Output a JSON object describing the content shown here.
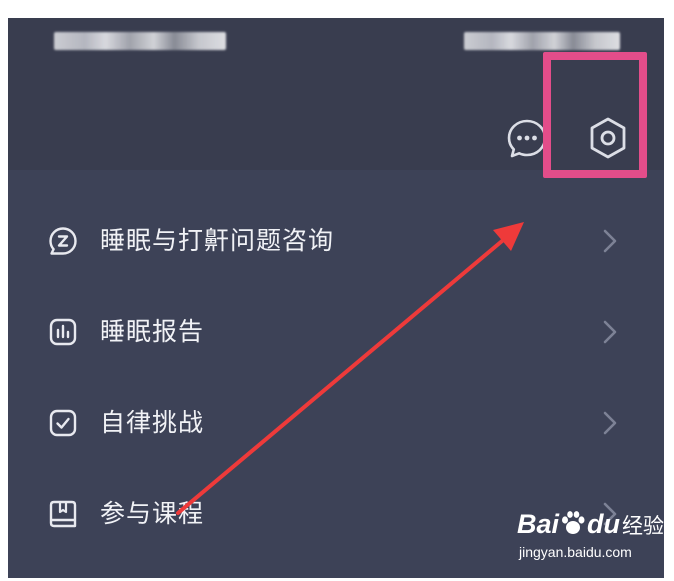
{
  "header": {
    "chat_icon": "chat-bubble-dots-icon",
    "settings_icon": "hexagon-gear-icon"
  },
  "menu": {
    "items": [
      {
        "label": "睡眠与打鼾问题咨询",
        "icon": "chat-bubble-z-icon"
      },
      {
        "label": "睡眠报告",
        "icon": "bar-chart-icon"
      },
      {
        "label": "自律挑战",
        "icon": "checkbox-icon"
      },
      {
        "label": "参与课程",
        "icon": "book-icon"
      }
    ]
  },
  "annotation": {
    "highlight_color": "#e34d8a",
    "arrow_color": "#ee3a3a"
  },
  "watermark": {
    "bai": "Bai",
    "du": "du",
    "jingyan": "经验",
    "url": "jingyan.baidu.com"
  },
  "colors": {
    "background": "#3d4257",
    "header_band": "#393d4f",
    "text": "#f1f2f6",
    "chevron": "#7d8296"
  }
}
